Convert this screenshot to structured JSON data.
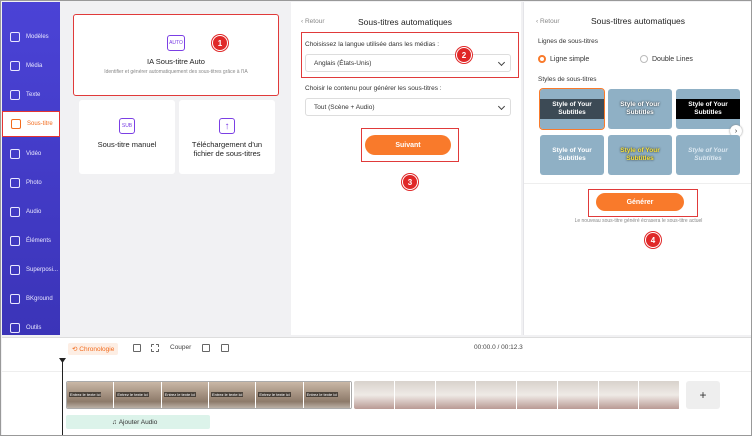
{
  "sidebar": {
    "items": [
      {
        "label": "Modèles",
        "icon": "templates-icon"
      },
      {
        "label": "Média",
        "icon": "media-icon"
      },
      {
        "label": "Texte",
        "icon": "text-icon"
      },
      {
        "label": "Sous-titre",
        "icon": "subtitle-icon",
        "active": true
      },
      {
        "label": "Vidéo",
        "icon": "video-icon"
      },
      {
        "label": "Photo",
        "icon": "photo-icon"
      },
      {
        "label": "Audio",
        "icon": "audio-icon"
      },
      {
        "label": "Éléments",
        "icon": "elements-icon"
      },
      {
        "label": "Superposi...",
        "icon": "overlay-icon"
      },
      {
        "label": "BKground",
        "icon": "background-icon"
      },
      {
        "label": "Outils",
        "icon": "tools-icon"
      }
    ]
  },
  "left": {
    "ai": {
      "icon_text": "AUTO",
      "title": "IA Sous-titre Auto",
      "desc": "Identifier et générer automatiquement des sous-titres grâce à l'IA"
    },
    "manual": {
      "icon_text": "SUB",
      "title": "Sous-titre manuel"
    },
    "upload": {
      "title": "Téléchargement d'un fichier de sous-titres"
    }
  },
  "middle": {
    "back": "Retour",
    "title": "Sous-titres automatiques",
    "lang_label": "Choisissez la langue utilisée dans les médias :",
    "lang_value": "Anglais (États-Unis)",
    "content_label": "Choisir le contenu pour générer les sous-titres :",
    "content_value": "Tout (Scène + Audio)",
    "next_button": "Suivant"
  },
  "right": {
    "back": "Retour",
    "title": "Sous-titres automatiques",
    "lines_label": "Lignes de sous-titres",
    "single_line": "Ligne simple",
    "double_lines": "Double Lines",
    "styles_label": "Styles de sous-titres",
    "style_text": "Style of Your Subtitles",
    "generate_button": "Générer",
    "note": "Le nouveau sous-titre généré écrasera le sous-titre actuel"
  },
  "badges": [
    "1",
    "2",
    "3",
    "4"
  ],
  "timeline": {
    "chronologie": "Chronologie",
    "couper": "Couper",
    "time": "00:00.0 / 00:12.3",
    "add_audio": "Ajouter Audio",
    "clip_text": "Entrez le texte ici",
    "plus": "+"
  },
  "colors": {
    "accent": "#f97a2b",
    "sidebar": "#4b43d6",
    "highlight": "#e03a3a"
  }
}
